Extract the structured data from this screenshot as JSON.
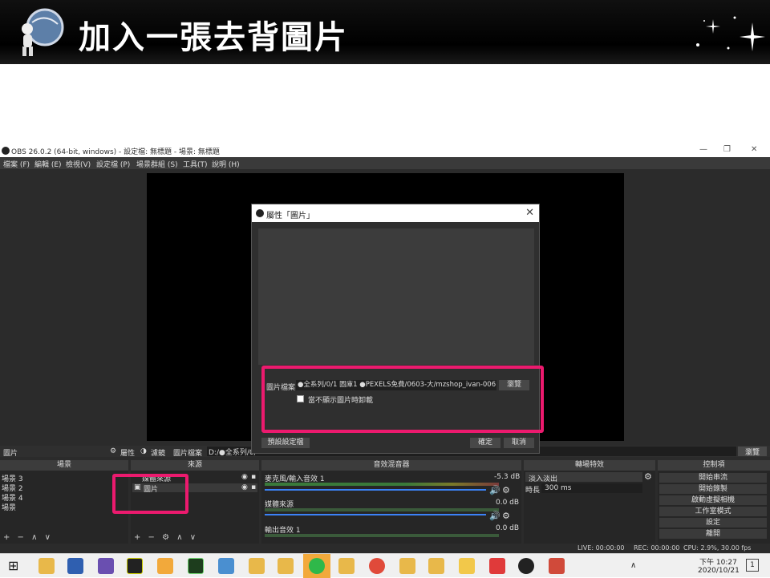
{
  "slide": {
    "title": "加入一張去背圖片"
  },
  "window": {
    "title": "OBS 26.0.2 (64-bit, windows) - 設定檔: 無標題 - 場景: 無標題",
    "menu": [
      "檔案 (F)",
      "編輯 (E)",
      "檢視(V)",
      "設定檔 (P)",
      "場景群組 (S)",
      "工具(T)",
      "說明 (H)"
    ]
  },
  "source_bar": {
    "name": "圖片",
    "properties": "屬性",
    "filters": "濾鏡",
    "image_file": "圖片檔案",
    "path": "D:/●全系列/0/",
    "browse": "瀏覽"
  },
  "panels": {
    "scenes": {
      "title": "場景",
      "items": [
        "場景 3",
        "場景 2",
        "場景 4",
        "場景"
      ],
      "footer": "+ − ∧ ∨"
    },
    "sources": {
      "title": "來源",
      "items": [
        "媒體來源",
        "圖片"
      ],
      "footer": "+ − ⚙ ∧ ∨"
    },
    "mixer": {
      "title": "音效混音器",
      "channels": [
        {
          "name": "麥克風/輸入音效 1",
          "db": "-5.3 dB"
        },
        {
          "name": "媒體來源",
          "db": "0.0 dB"
        },
        {
          "name": "輸出音效 1",
          "db": "0.0 dB"
        }
      ]
    },
    "transitions": {
      "title": "轉場特效",
      "selected": "淡入淡出",
      "duration_label": "時長",
      "duration": "300 ms"
    },
    "controls": {
      "title": "控制項",
      "buttons": [
        "開始串流",
        "開始錄製",
        "啟動虛擬相機",
        "工作室模式",
        "設定",
        "離開"
      ]
    }
  },
  "status": {
    "live": "LIVE: 00:00:00",
    "rec": "REC: 00:00:00",
    "cpu": "CPU: 2.9%, 30.00 fps"
  },
  "dialog": {
    "title": "屬性「圖片」",
    "file_label": "圖片檔案",
    "file_path": "●全系列/0/1 圖庫1 ●PEXELS免費/0603-大/mzshop_ivan-006.jpeg",
    "browse": "瀏覽",
    "checkbox_label": "當不顯示圖片時卸載",
    "defaults": "預設設定檔",
    "ok": "確定",
    "cancel": "取消"
  },
  "taskbar": {
    "time": "下午 10:27",
    "date": "2020/10/21",
    "notification_count": "1"
  },
  "colors": {
    "highlight": "#ec1a6e",
    "accent": "#3b82f6"
  }
}
